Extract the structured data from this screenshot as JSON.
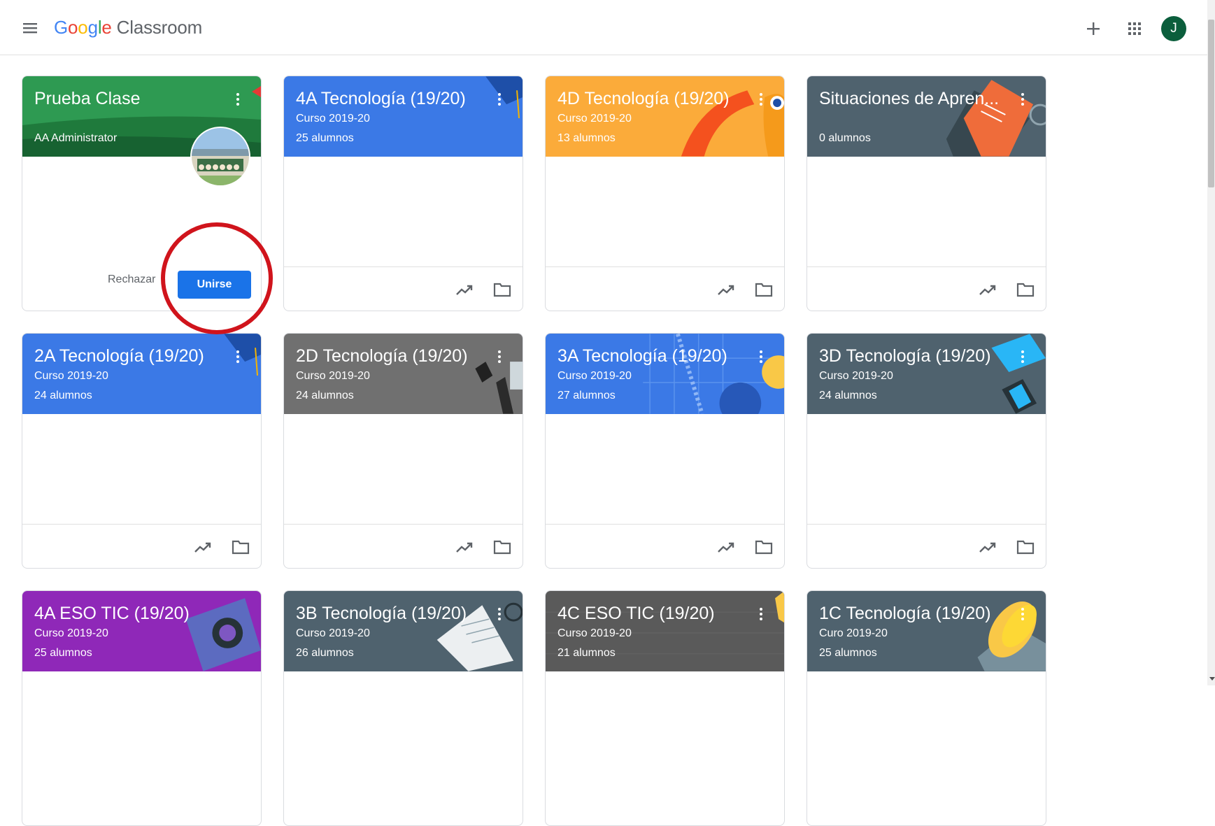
{
  "app": {
    "logo": {
      "g1": "G",
      "g2": "o",
      "g3": "o",
      "g4": "g",
      "g5": "l",
      "g6": "e",
      "product": "Classroom"
    },
    "user_initial": "J",
    "icons": {
      "menu": "menu-icon",
      "add": "plus-icon",
      "apps": "apps-grid-icon"
    }
  },
  "colors": {
    "green": "#2e9a52",
    "blue": "#3b79e6",
    "orange": "#fbab3a",
    "slate": "#4f626e",
    "gray": "#707070",
    "purple": "#8f28b8",
    "dark": "#5a5a5a",
    "accent": "#1a73e8",
    "highlight": "#d0141c"
  },
  "invite": {
    "title": "Prueba Clase",
    "teacher": "AA Administrator",
    "reject_label": "Rechazar",
    "join_label": "Unirse"
  },
  "classes": [
    {
      "title": "4A Tecnología (19/20)",
      "subtitle": "Curso 2019-20",
      "students": "25 alumnos"
    },
    {
      "title": "4D Tecnología (19/20)",
      "subtitle": "Curso 2019-20",
      "students": "13 alumnos"
    },
    {
      "title": "Situaciones de Apren...",
      "subtitle": "",
      "students": "0 alumnos"
    },
    {
      "title": "2A Tecnología (19/20)",
      "subtitle": "Curso 2019-20",
      "students": "24 alumnos"
    },
    {
      "title": "2D Tecnología (19/20)",
      "subtitle": "Curso 2019-20",
      "students": "24 alumnos"
    },
    {
      "title": "3A Tecnología (19/20)",
      "subtitle": "Curso 2019-20",
      "students": "27 alumnos"
    },
    {
      "title": "3D Tecnología (19/20)",
      "subtitle": "Curso 2019-20",
      "students": "24 alumnos"
    },
    {
      "title": "4A ESO TIC (19/20)",
      "subtitle": "Curso 2019-20",
      "students": "25 alumnos"
    },
    {
      "title": "3B Tecnología (19/20)",
      "subtitle": "Curso 2019-20",
      "students": "26 alumnos"
    },
    {
      "title": "4C ESO TIC (19/20)",
      "subtitle": "Curso 2019-20",
      "students": "21 alumnos"
    },
    {
      "title": "1C Tecnología (19/20)",
      "subtitle": "Curo 2019-20",
      "students": "25 alumnos"
    }
  ]
}
